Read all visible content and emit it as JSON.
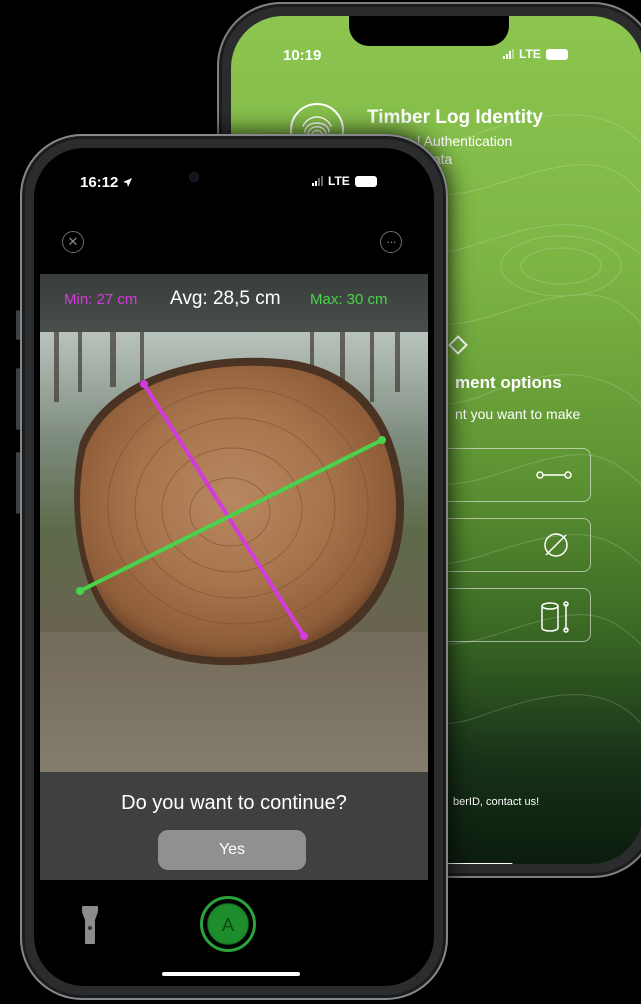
{
  "back_phone": {
    "status": {
      "time": "10:19",
      "network": "LTE"
    },
    "brand": {
      "title": "Timber Log Identity",
      "subtitle_line1": "enance  |  Authentication",
      "subtitle_line2": "ility  |  Big Data",
      "icon": "fingerprint-icon"
    },
    "measurement": {
      "title": "ment options",
      "subtitle": "nt you want to make",
      "icon": "diamond-icon",
      "options": [
        {
          "icon": "line-measure-icon"
        },
        {
          "icon": "ellipse-measure-icon"
        },
        {
          "icon": "cylinder-measure-icon"
        }
      ]
    },
    "contact": "berID, contact us!",
    "colors": {
      "gradient_top": "#8cc64f",
      "gradient_bottom": "#0c1c0d"
    }
  },
  "front_phone": {
    "status": {
      "time": "16:12",
      "network": "LTE"
    },
    "top_icons": [
      "close-icon",
      "more-icon"
    ],
    "stats": {
      "min": "Min: 27 cm",
      "avg": "Avg:  28,5 cm",
      "max": "Max:  30 cm"
    },
    "measure_lines": {
      "min_color": "#d23bdc",
      "max_color": "#47d44a"
    },
    "question": "Do you want to continue?",
    "yes_label": "Yes",
    "capture_label": "A",
    "flashlight_icon": "flashlight-icon"
  }
}
